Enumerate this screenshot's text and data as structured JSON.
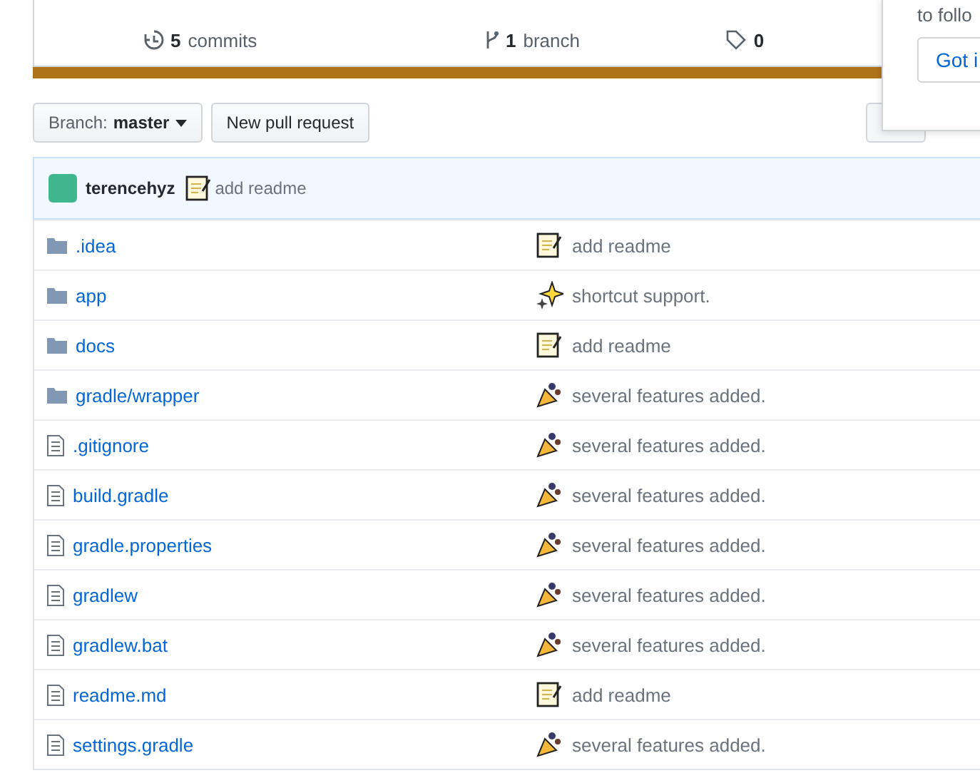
{
  "summary": {
    "commits": {
      "count": "5",
      "label": "commits"
    },
    "branches": {
      "count": "1",
      "label": "branch"
    },
    "tags": {
      "count": "0"
    }
  },
  "popover": {
    "text": "to follo",
    "button": "Got i"
  },
  "toolbar": {
    "branch_label": "Branch:",
    "branch": "master",
    "new_pr": "New pull request"
  },
  "latest_commit": {
    "author": "terencehyz",
    "kind": "memo",
    "message": "add readme"
  },
  "files": [
    {
      "kind": "folder",
      "name": ".idea",
      "commit": {
        "kind": "memo",
        "message": "add readme"
      }
    },
    {
      "kind": "folder",
      "name": "app",
      "commit": {
        "kind": "sparkles",
        "message": "shortcut support."
      }
    },
    {
      "kind": "folder",
      "name": "docs",
      "commit": {
        "kind": "memo",
        "message": "add readme"
      }
    },
    {
      "kind": "folder",
      "name": "gradle/wrapper",
      "commit": {
        "kind": "tada",
        "message": "several features added."
      }
    },
    {
      "kind": "file",
      "name": ".gitignore",
      "commit": {
        "kind": "tada",
        "message": "several features added."
      }
    },
    {
      "kind": "file",
      "name": "build.gradle",
      "commit": {
        "kind": "tada",
        "message": "several features added."
      }
    },
    {
      "kind": "file",
      "name": "gradle.properties",
      "commit": {
        "kind": "tada",
        "message": "several features added."
      }
    },
    {
      "kind": "file",
      "name": "gradlew",
      "commit": {
        "kind": "tada",
        "message": "several features added."
      }
    },
    {
      "kind": "file",
      "name": "gradlew.bat",
      "commit": {
        "kind": "tada",
        "message": "several features added."
      }
    },
    {
      "kind": "file",
      "name": "readme.md",
      "commit": {
        "kind": "memo",
        "message": "add readme"
      }
    },
    {
      "kind": "file",
      "name": "settings.gradle",
      "commit": {
        "kind": "tada",
        "message": "several features added."
      }
    }
  ]
}
